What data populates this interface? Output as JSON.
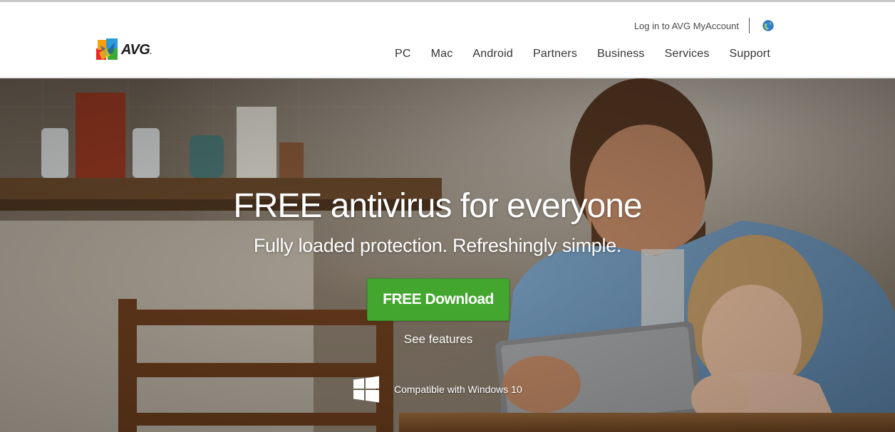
{
  "header": {
    "logo_text": "AVG",
    "login_label": "Log in to AVG MyAccount",
    "language_icon": "globe-icon",
    "nav": [
      "PC",
      "Mac",
      "Android",
      "Partners",
      "Business",
      "Services",
      "Support"
    ]
  },
  "hero": {
    "title": "FREE antivirus for everyone",
    "subtitle": "Fully loaded protection. Refreshingly simple.",
    "download_label": "FREE Download",
    "see_features_label": "See features",
    "compat_icon": "windows-icon",
    "compat_text": "Compatible with Windows 10"
  },
  "colors": {
    "download_button": "#43a62f",
    "nav_text": "#333333",
    "hero_text": "#ffffff"
  }
}
